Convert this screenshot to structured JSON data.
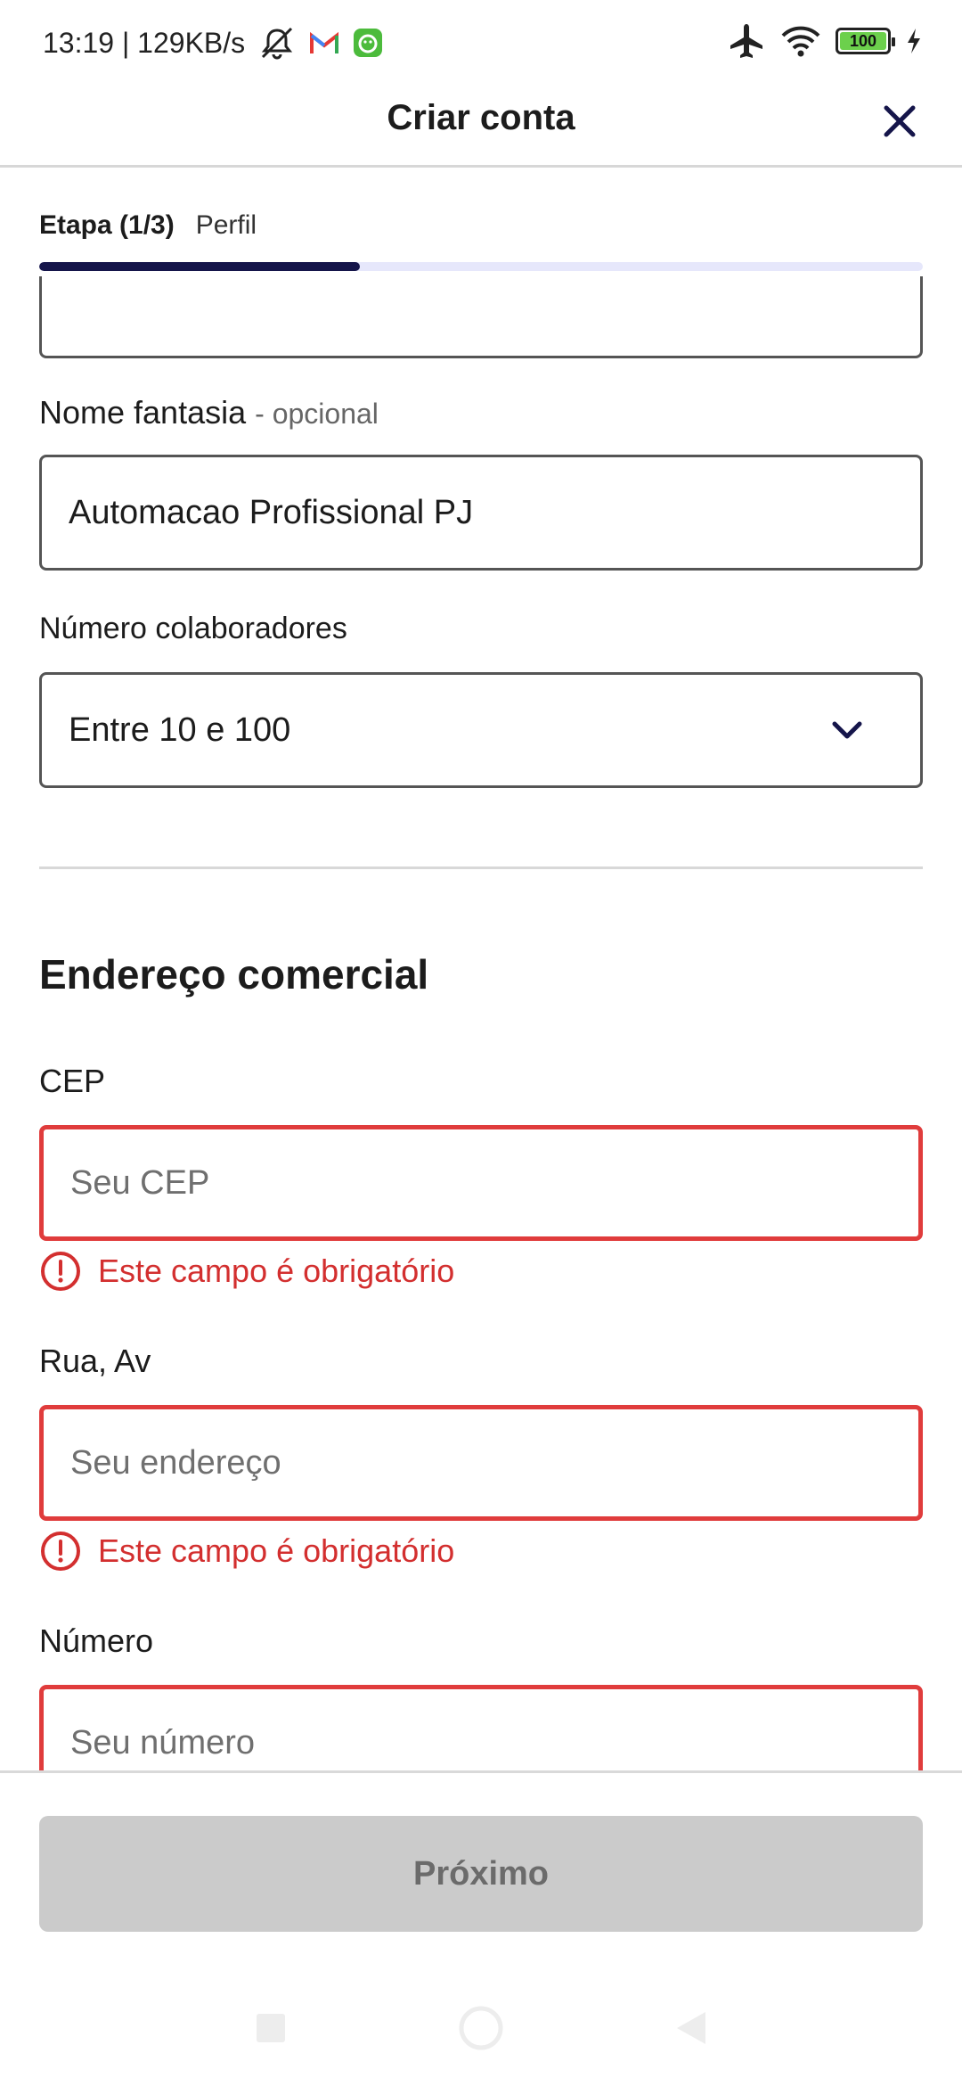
{
  "status_bar": {
    "time_speed": "13:19 | 129KB/s",
    "battery_level": "100",
    "icons": [
      "mute-icon",
      "gmail-icon",
      "app-notification-icon",
      "airplane-mode-icon",
      "wifi-icon",
      "battery-icon",
      "charging-icon"
    ]
  },
  "header": {
    "title": "Criar conta",
    "close_icon": "close-icon"
  },
  "progress": {
    "step_label": "Etapa (1/3)",
    "step_name": "Perfil",
    "fraction": 0.363
  },
  "form": {
    "trade_name": {
      "label": "Nome fantasia",
      "optional": "- opcional",
      "value": "Automacao Profissional PJ"
    },
    "employees": {
      "label": "Número colaboradores",
      "value": "Entre 10 e 100"
    },
    "address_section_title": "Endereço comercial",
    "cep": {
      "label": "CEP",
      "placeholder": "Seu CEP",
      "error": "Este campo é obrigatório"
    },
    "street": {
      "label": "Rua, Av",
      "placeholder": "Seu endereço",
      "error": "Este campo é obrigatório"
    },
    "number": {
      "label": "Número",
      "placeholder": "Seu número"
    }
  },
  "footer": {
    "next_label": "Próximo"
  },
  "colors": {
    "primary": "#15154a",
    "error": "#d32f2f",
    "disabled_button": "#cbcbcb"
  }
}
